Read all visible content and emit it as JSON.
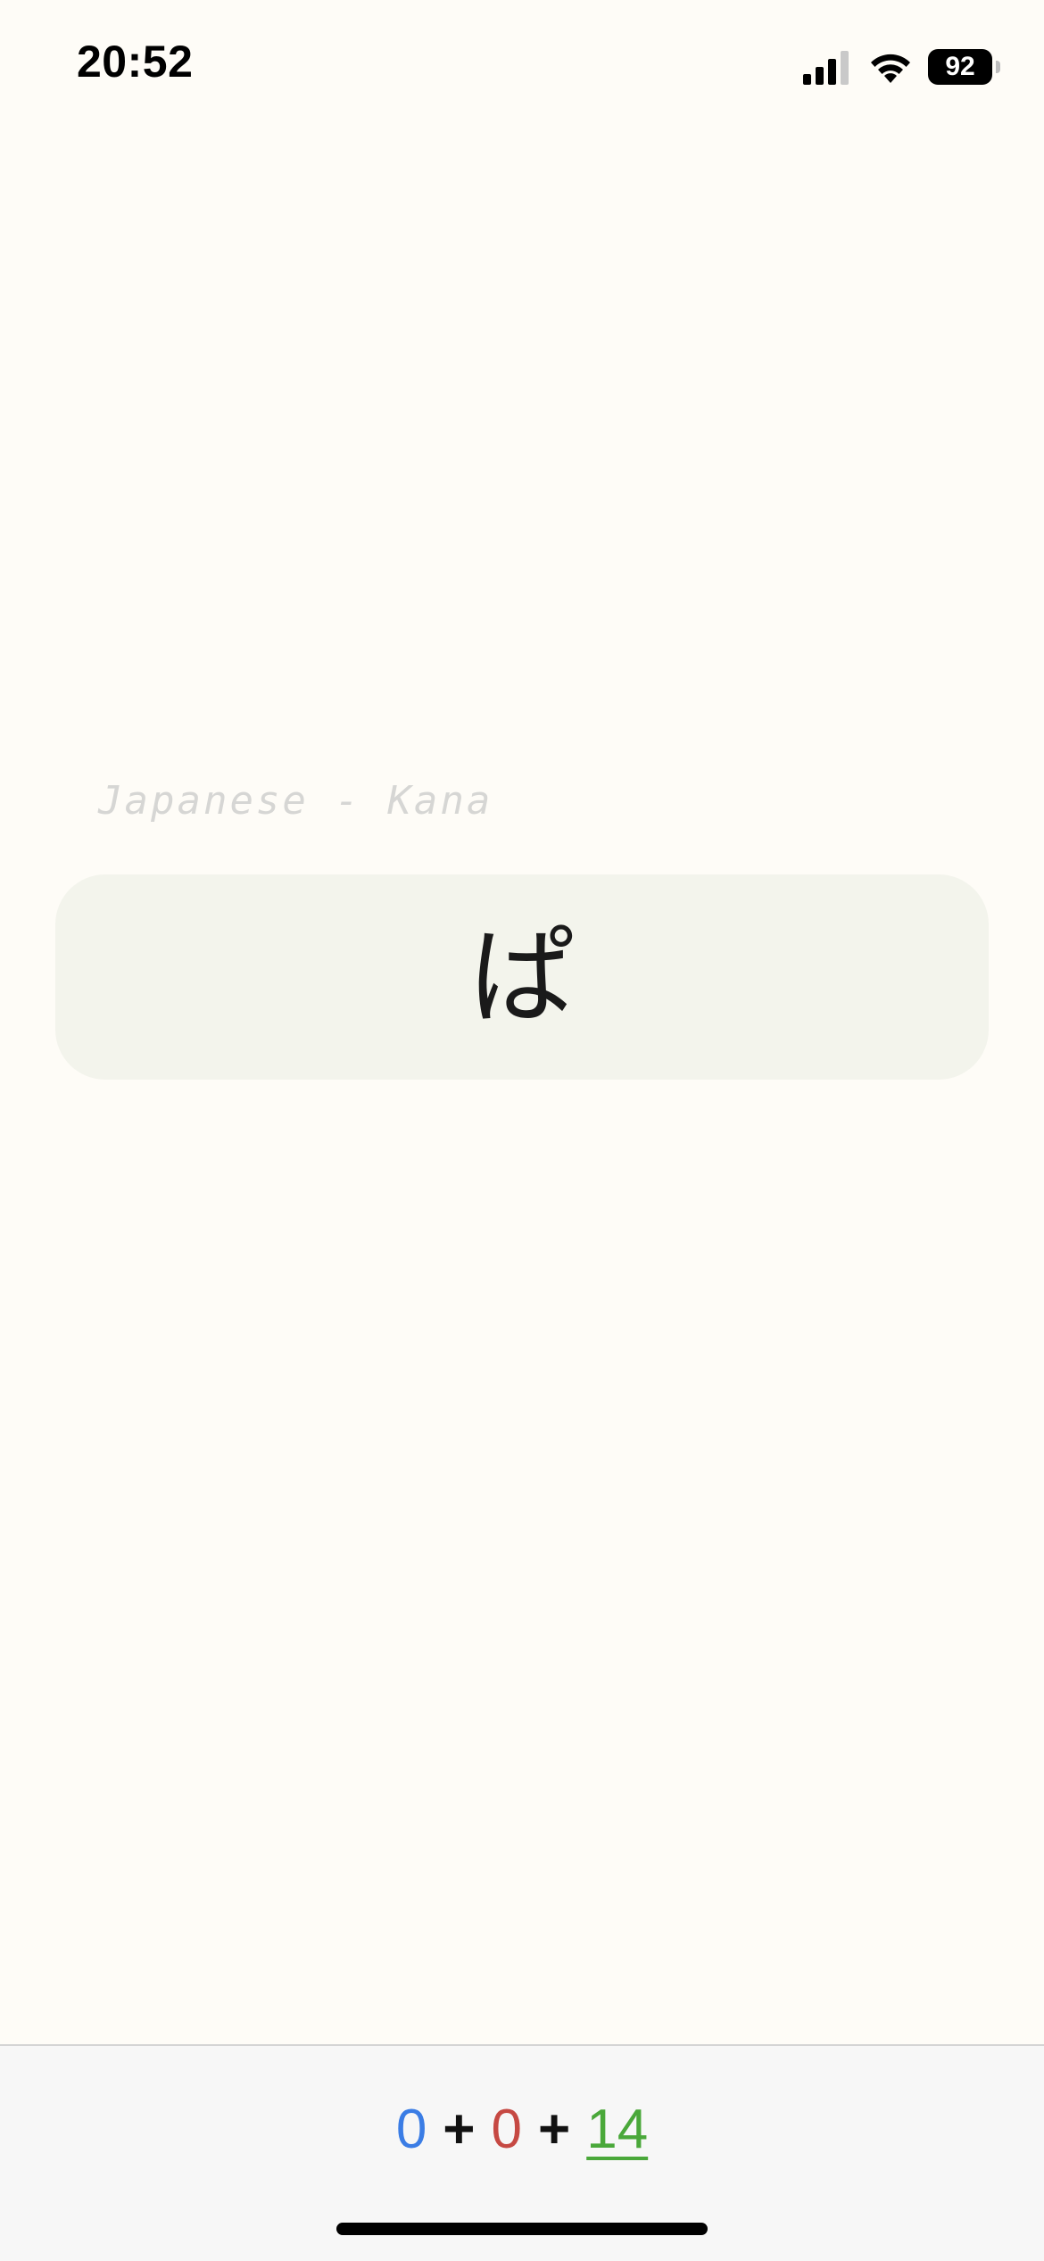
{
  "status_bar": {
    "time": "20:52",
    "battery_level": "92",
    "icons": [
      "signal-icon",
      "wifi-icon",
      "battery-icon"
    ]
  },
  "deck": {
    "label": "Japanese - Kana"
  },
  "card": {
    "front": "ぱ"
  },
  "score": {
    "blue_count": "0",
    "plus_1": "+",
    "red_count": "0",
    "plus_2": "+",
    "green_count": "14",
    "colors": {
      "blue": "#3b7de5",
      "red": "#c64943",
      "green": "#4aa83a"
    }
  },
  "colors": {
    "background": "#fefcf7",
    "card_background": "#f3f4ec",
    "bottom_bar": "#f7f7f7"
  }
}
